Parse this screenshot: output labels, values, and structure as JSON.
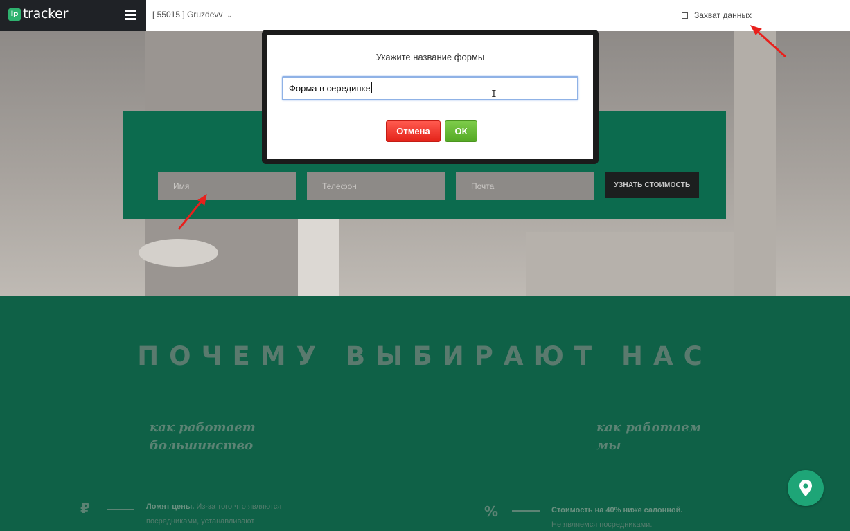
{
  "topbar": {
    "brand_mark": "lp",
    "brand_name": "tracker",
    "project_label": "[ 55015 ] Gruzdevv",
    "capture_label": "Захват данных"
  },
  "hero": {
    "form": {
      "name_placeholder": "Имя",
      "phone_placeholder": "Телефон",
      "email_placeholder": "Почта",
      "submit_label": "УЗНАТЬ СТОИМОСТЬ"
    }
  },
  "section": {
    "title": "ПОЧЕМУ ВЫБИРАЮТ НАС",
    "left_heading": "как работает большинство",
    "right_heading": "как работаем мы",
    "left_symbol": "₽",
    "right_symbol": "%",
    "left_feature_bold": "Ломят цены.",
    "left_feature_text": " Из-за того что являются посредниками, устанавливают",
    "right_feature_bold": "Стоимость на 40% ниже салонной.",
    "right_feature_text": "Не являемся посредниками."
  },
  "dialog": {
    "title": "Укажите название формы",
    "input_value": "Форма в серединке",
    "cancel_label": "Отмена",
    "ok_label": "ОК"
  },
  "colors": {
    "brand_bg": "#1f2226",
    "brand_accent": "#2fb26f",
    "form_band": "#0c6b4e",
    "section_bg": "#0f6147",
    "cancel_red": "#e4231a",
    "ok_green": "#55a925",
    "annotation_arrow": "#e8201c"
  },
  "icons": {
    "menu": "hamburger-icon",
    "project_dropdown": "chevron-down-icon",
    "capture_checkbox": "checkbox-icon",
    "map": "map-pin-icon",
    "cursor": "text-cursor-icon"
  }
}
